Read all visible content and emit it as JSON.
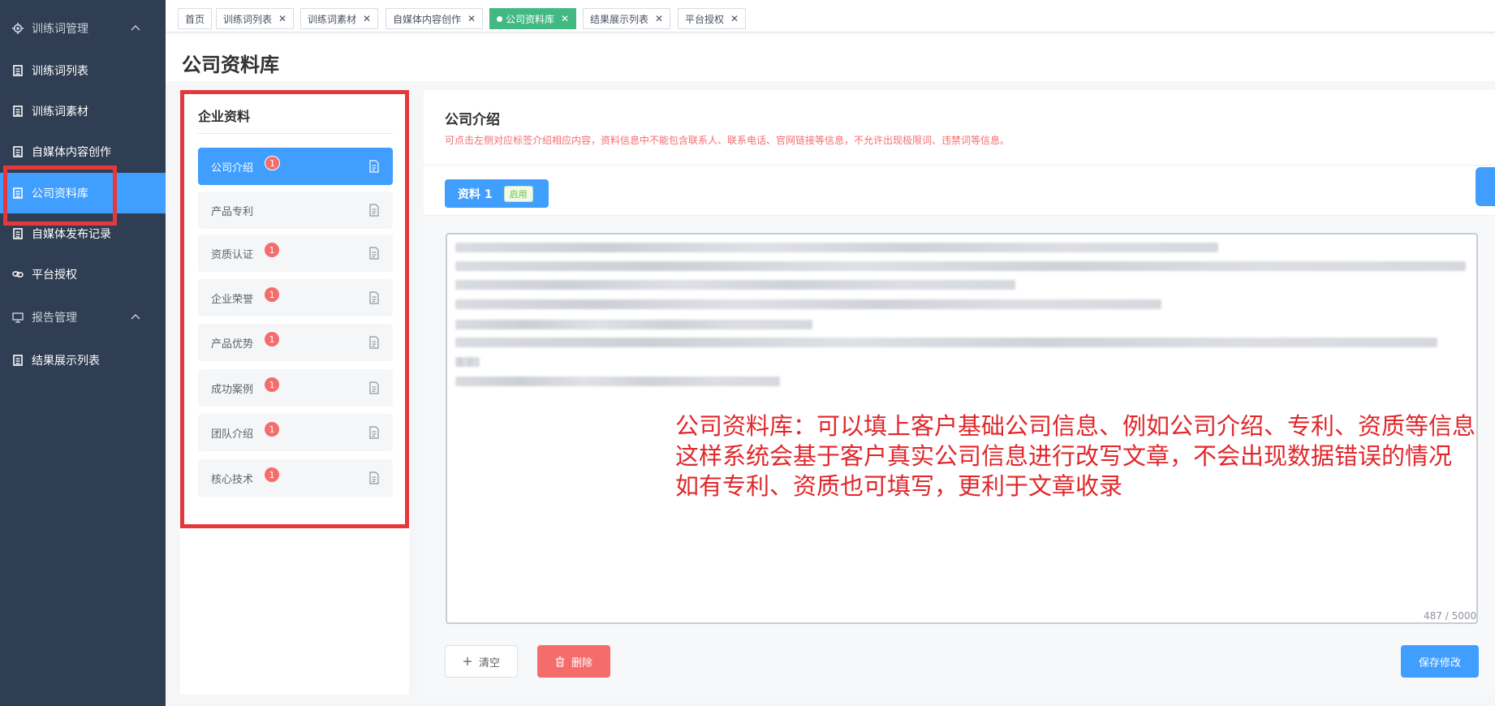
{
  "sidebar": {
    "items": [
      {
        "label": "训练词管理",
        "icon": "gear-icon",
        "parent": true
      },
      {
        "label": "训练词列表",
        "icon": "document-icon"
      },
      {
        "label": "训练词素材",
        "icon": "document-icon"
      },
      {
        "label": "自媒体内容创作",
        "icon": "document-icon"
      },
      {
        "label": "公司资料库",
        "icon": "document-icon",
        "active": true
      },
      {
        "label": "自媒体发布记录",
        "icon": "document-icon"
      },
      {
        "label": "平台授权",
        "icon": "link-icon"
      },
      {
        "label": "报告管理",
        "icon": "monitor-icon",
        "parent": true
      },
      {
        "label": "结果展示列表",
        "icon": "document-icon"
      }
    ]
  },
  "tags": [
    {
      "label": "首页"
    },
    {
      "label": "训练词列表"
    },
    {
      "label": "训练词素材"
    },
    {
      "label": "自媒体内容创作"
    },
    {
      "label": "公司资料库",
      "active": true
    },
    {
      "label": "结果展示列表"
    },
    {
      "label": "平台授权"
    }
  ],
  "page": {
    "title": "公司资料库"
  },
  "left_panel": {
    "title": "企业资料",
    "items": [
      {
        "label": "公司介绍",
        "badge": "1",
        "active": true
      },
      {
        "label": "产品专利",
        "badge": ""
      },
      {
        "label": "资质认证",
        "badge": "1"
      },
      {
        "label": "企业荣誉",
        "badge": "1"
      },
      {
        "label": "产品优势",
        "badge": "1"
      },
      {
        "label": "成功案例",
        "badge": "1"
      },
      {
        "label": "团队介绍",
        "badge": "1"
      },
      {
        "label": "核心技术",
        "badge": "1"
      }
    ]
  },
  "right_panel": {
    "title": "公司介绍",
    "hint": "可点击左侧对应标签介绍相应内容，资料信息中不能包含联系人、联系电话、官网链接等信息，不允许出现极限词、违禁词等信息。",
    "resource_tab": {
      "label": "资料 1",
      "status": "启用"
    },
    "char_count": "487 / 5000",
    "annotation": [
      "公司资料库：可以填上客户基础公司信息、例如公司介绍、专利、资质等信息",
      "这样系统会基于客户真实公司信息进行改写文章，不会出现数据错误的情况",
      "如有专利、资质也可填写，更利于文章收录"
    ]
  },
  "buttons": {
    "clear": "清空",
    "delete": "删除",
    "save": "保存修改"
  },
  "colors": {
    "sidebar_bg": "#2f3e52",
    "primary": "#409eff",
    "tag_active": "#42b983",
    "danger": "#f56c6c",
    "highlight_box": "#e5383c",
    "annotation_text": "#e0272b"
  }
}
